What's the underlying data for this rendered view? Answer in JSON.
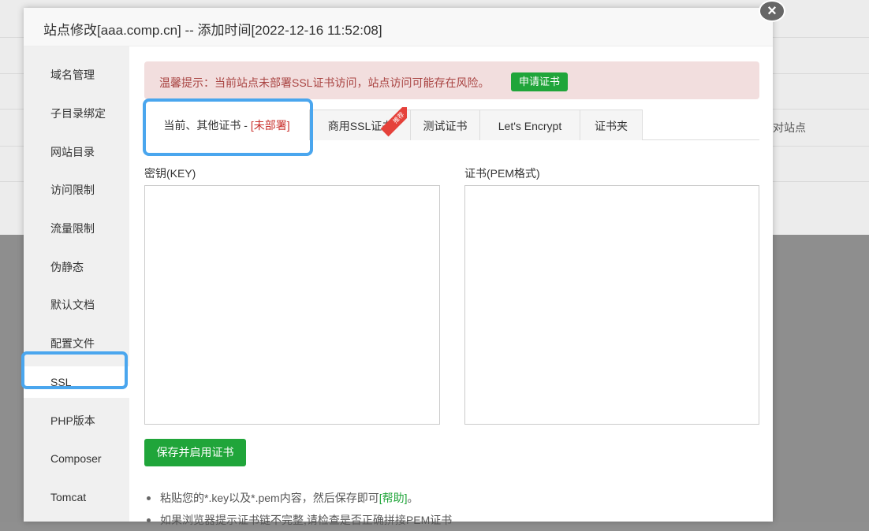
{
  "background": {
    "right_text": "对站点"
  },
  "modal": {
    "title": "站点修改[aaa.comp.cn] -- 添加时间[2022-12-16 11:52:08]",
    "close_icon": "close-icon"
  },
  "sidebar": {
    "items": [
      {
        "label": "域名管理"
      },
      {
        "label": "子目录绑定"
      },
      {
        "label": "网站目录"
      },
      {
        "label": "访问限制"
      },
      {
        "label": "流量限制"
      },
      {
        "label": "伪静态"
      },
      {
        "label": "默认文档"
      },
      {
        "label": "配置文件"
      },
      {
        "label": "SSL",
        "active": true
      },
      {
        "label": "PHP版本"
      },
      {
        "label": "Composer"
      },
      {
        "label": "Tomcat"
      }
    ]
  },
  "alert": {
    "text": "温馨提示：当前站点未部署SSL证书访问，站点访问可能存在风险。",
    "button": "申请证书"
  },
  "tabs": {
    "current_prefix": "当前、其他证书 - ",
    "current_status": "[未部署]",
    "commercial": "商用SSL证书",
    "recommend_badge": "推荐",
    "test": "测试证书",
    "letsencrypt": "Let's Encrypt",
    "folder": "证书夹"
  },
  "form": {
    "key_label": "密钥(KEY)",
    "key_value": "",
    "cert_label": "证书(PEM格式)",
    "cert_value": "",
    "save_button": "保存并启用证书"
  },
  "notes": {
    "first_text": "粘贴您的*.key以及*.pem内容，然后保存即可",
    "help_link": "[帮助]",
    "first_suffix": "。",
    "second_text": "如果浏览器提示证书链不完整,请检查是否正确拼接PEM证书"
  },
  "colors": {
    "accent_green": "#20a53a",
    "alert_background": "#f2dede",
    "alert_text": "#a94442",
    "highlight_blue": "#4aa6ee",
    "badge_red": "#e5413a"
  }
}
